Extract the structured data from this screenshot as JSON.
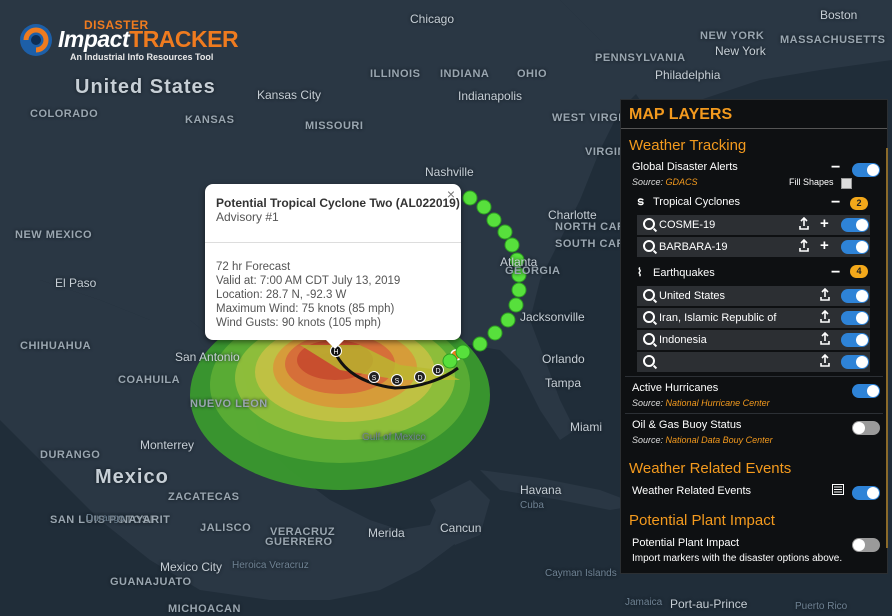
{
  "logo": {
    "line1": "DISASTER",
    "brand_a": "Impact",
    "brand_b": "TRACKER",
    "tagline": "An Industrial Info Resources Tool"
  },
  "map_labels": {
    "countries": [
      "United States",
      "Mexico"
    ],
    "states": [
      "COLORADO",
      "KANSAS",
      "MISSOURI",
      "ILLINOIS",
      "INDIANA",
      "OHIO",
      "PENNSYLVANIA",
      "NEW YORK",
      "MASSACHUSETTS",
      "WEST VIRGINIA",
      "VIRGINIA",
      "NORTH CAROLINA",
      "SOUTH CAROLINA",
      "GEORGIA",
      "NEW MEXICO",
      "CHIHUAHUA",
      "COAHUILA",
      "NUEVO LEON",
      "DURANGO",
      "ZACATECAS",
      "SAN LUIS POTOSI",
      "NAYARIT",
      "JALISCO",
      "GUANAJUATO",
      "MICHOACAN",
      "GUERRERO",
      "VERACRUZ"
    ],
    "cities": [
      "Chicago",
      "Boston",
      "New York",
      "Philadelphia",
      "Indianapolis",
      "Kansas City",
      "Nashville",
      "Charlotte",
      "Atlanta",
      "Jacksonville",
      "Orlando",
      "Tampa",
      "Miami",
      "El Paso",
      "San Antonio",
      "Monterrey",
      "Mexico City",
      "Merida",
      "Cancun",
      "Havana",
      "Port-au-Prince"
    ],
    "water": [
      "Gulf of Mexico",
      "Cayman Islands",
      "Jamaica",
      "Puerto Rico"
    ],
    "small": [
      "Durango",
      "Heroica Veracruz",
      "Cuba"
    ]
  },
  "popup": {
    "close": "×",
    "title": "Potential Tropical Cyclone Two (AL022019)",
    "advisory": "Advisory #1",
    "forecast_title": "72 hr Forecast",
    "valid_at": "Valid at: 7:00 AM CDT July 13, 2019",
    "location": "Location: 28.7 N, -92.3 W",
    "max_wind": "Maximum Wind: 75 knots (85 mph)",
    "gusts": "Wind Gusts: 90 knots (105 mph)"
  },
  "storm_markers": [
    "H",
    "S",
    "S",
    "D",
    "D"
  ],
  "panel": {
    "title": "MAP LAYERS",
    "weather_tracking": {
      "heading": "Weather Tracking",
      "gdacs_label": "Global Disaster Alerts",
      "gdacs_source_prefix": "Source:",
      "gdacs_source": "GDACS",
      "fill_shapes": "Fill Shapes",
      "tropical": {
        "label": "Tropical Cyclones",
        "count": "2",
        "items": [
          "COSME-19",
          "BARBARA-19"
        ]
      },
      "earthquakes": {
        "label": "Earthquakes",
        "count": "4",
        "items": [
          "United States",
          "Iran, Islamic Republic of",
          "Indonesia",
          ""
        ]
      },
      "hurricanes_label": "Active Hurricanes",
      "hurricanes_source_prefix": "Source:",
      "hurricanes_source": "National Hurricane Center",
      "buoy_label": "Oil & Gas Buoy Status",
      "buoy_source_prefix": "Source:",
      "buoy_source": "National Data Bouy Center"
    },
    "weather_events": {
      "heading": "Weather Related Events",
      "label": "Weather Related Events"
    },
    "plant_impact": {
      "heading": "Potential Plant Impact",
      "label": "Potential Plant Impact",
      "hint": "Import markers with the disaster options above."
    }
  },
  "colors": {
    "accent": "#f39a1e",
    "toggle_on": "#2e83d7",
    "toggle_off": "#9a9a9a",
    "panel_bg": "#0e1012"
  }
}
